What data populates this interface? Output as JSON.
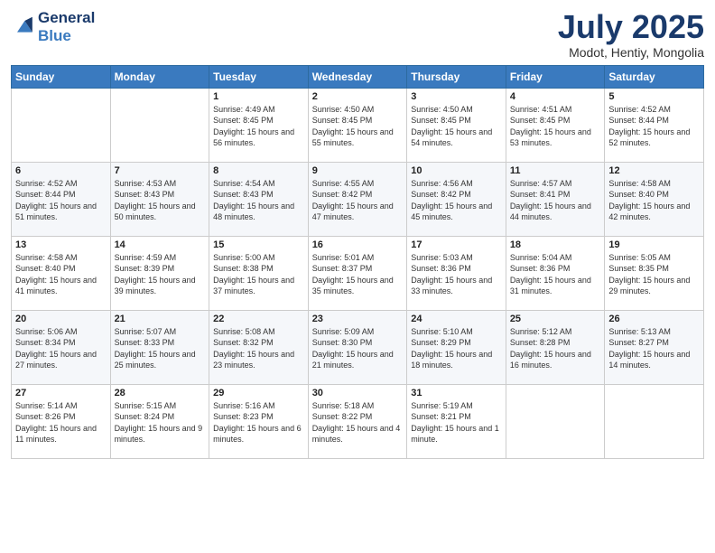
{
  "logo": {
    "line1": "General",
    "line2": "Blue"
  },
  "title": "July 2025",
  "location": "Modot, Hentiy, Mongolia",
  "days_header": [
    "Sunday",
    "Monday",
    "Tuesday",
    "Wednesday",
    "Thursday",
    "Friday",
    "Saturday"
  ],
  "weeks": [
    [
      {
        "day": "",
        "sunrise": "",
        "sunset": "",
        "daylight": ""
      },
      {
        "day": "",
        "sunrise": "",
        "sunset": "",
        "daylight": ""
      },
      {
        "day": "1",
        "sunrise": "Sunrise: 4:49 AM",
        "sunset": "Sunset: 8:45 PM",
        "daylight": "Daylight: 15 hours and 56 minutes."
      },
      {
        "day": "2",
        "sunrise": "Sunrise: 4:50 AM",
        "sunset": "Sunset: 8:45 PM",
        "daylight": "Daylight: 15 hours and 55 minutes."
      },
      {
        "day": "3",
        "sunrise": "Sunrise: 4:50 AM",
        "sunset": "Sunset: 8:45 PM",
        "daylight": "Daylight: 15 hours and 54 minutes."
      },
      {
        "day": "4",
        "sunrise": "Sunrise: 4:51 AM",
        "sunset": "Sunset: 8:45 PM",
        "daylight": "Daylight: 15 hours and 53 minutes."
      },
      {
        "day": "5",
        "sunrise": "Sunrise: 4:52 AM",
        "sunset": "Sunset: 8:44 PM",
        "daylight": "Daylight: 15 hours and 52 minutes."
      }
    ],
    [
      {
        "day": "6",
        "sunrise": "Sunrise: 4:52 AM",
        "sunset": "Sunset: 8:44 PM",
        "daylight": "Daylight: 15 hours and 51 minutes."
      },
      {
        "day": "7",
        "sunrise": "Sunrise: 4:53 AM",
        "sunset": "Sunset: 8:43 PM",
        "daylight": "Daylight: 15 hours and 50 minutes."
      },
      {
        "day": "8",
        "sunrise": "Sunrise: 4:54 AM",
        "sunset": "Sunset: 8:43 PM",
        "daylight": "Daylight: 15 hours and 48 minutes."
      },
      {
        "day": "9",
        "sunrise": "Sunrise: 4:55 AM",
        "sunset": "Sunset: 8:42 PM",
        "daylight": "Daylight: 15 hours and 47 minutes."
      },
      {
        "day": "10",
        "sunrise": "Sunrise: 4:56 AM",
        "sunset": "Sunset: 8:42 PM",
        "daylight": "Daylight: 15 hours and 45 minutes."
      },
      {
        "day": "11",
        "sunrise": "Sunrise: 4:57 AM",
        "sunset": "Sunset: 8:41 PM",
        "daylight": "Daylight: 15 hours and 44 minutes."
      },
      {
        "day": "12",
        "sunrise": "Sunrise: 4:58 AM",
        "sunset": "Sunset: 8:40 PM",
        "daylight": "Daylight: 15 hours and 42 minutes."
      }
    ],
    [
      {
        "day": "13",
        "sunrise": "Sunrise: 4:58 AM",
        "sunset": "Sunset: 8:40 PM",
        "daylight": "Daylight: 15 hours and 41 minutes."
      },
      {
        "day": "14",
        "sunrise": "Sunrise: 4:59 AM",
        "sunset": "Sunset: 8:39 PM",
        "daylight": "Daylight: 15 hours and 39 minutes."
      },
      {
        "day": "15",
        "sunrise": "Sunrise: 5:00 AM",
        "sunset": "Sunset: 8:38 PM",
        "daylight": "Daylight: 15 hours and 37 minutes."
      },
      {
        "day": "16",
        "sunrise": "Sunrise: 5:01 AM",
        "sunset": "Sunset: 8:37 PM",
        "daylight": "Daylight: 15 hours and 35 minutes."
      },
      {
        "day": "17",
        "sunrise": "Sunrise: 5:03 AM",
        "sunset": "Sunset: 8:36 PM",
        "daylight": "Daylight: 15 hours and 33 minutes."
      },
      {
        "day": "18",
        "sunrise": "Sunrise: 5:04 AM",
        "sunset": "Sunset: 8:36 PM",
        "daylight": "Daylight: 15 hours and 31 minutes."
      },
      {
        "day": "19",
        "sunrise": "Sunrise: 5:05 AM",
        "sunset": "Sunset: 8:35 PM",
        "daylight": "Daylight: 15 hours and 29 minutes."
      }
    ],
    [
      {
        "day": "20",
        "sunrise": "Sunrise: 5:06 AM",
        "sunset": "Sunset: 8:34 PM",
        "daylight": "Daylight: 15 hours and 27 minutes."
      },
      {
        "day": "21",
        "sunrise": "Sunrise: 5:07 AM",
        "sunset": "Sunset: 8:33 PM",
        "daylight": "Daylight: 15 hours and 25 minutes."
      },
      {
        "day": "22",
        "sunrise": "Sunrise: 5:08 AM",
        "sunset": "Sunset: 8:32 PM",
        "daylight": "Daylight: 15 hours and 23 minutes."
      },
      {
        "day": "23",
        "sunrise": "Sunrise: 5:09 AM",
        "sunset": "Sunset: 8:30 PM",
        "daylight": "Daylight: 15 hours and 21 minutes."
      },
      {
        "day": "24",
        "sunrise": "Sunrise: 5:10 AM",
        "sunset": "Sunset: 8:29 PM",
        "daylight": "Daylight: 15 hours and 18 minutes."
      },
      {
        "day": "25",
        "sunrise": "Sunrise: 5:12 AM",
        "sunset": "Sunset: 8:28 PM",
        "daylight": "Daylight: 15 hours and 16 minutes."
      },
      {
        "day": "26",
        "sunrise": "Sunrise: 5:13 AM",
        "sunset": "Sunset: 8:27 PM",
        "daylight": "Daylight: 15 hours and 14 minutes."
      }
    ],
    [
      {
        "day": "27",
        "sunrise": "Sunrise: 5:14 AM",
        "sunset": "Sunset: 8:26 PM",
        "daylight": "Daylight: 15 hours and 11 minutes."
      },
      {
        "day": "28",
        "sunrise": "Sunrise: 5:15 AM",
        "sunset": "Sunset: 8:24 PM",
        "daylight": "Daylight: 15 hours and 9 minutes."
      },
      {
        "day": "29",
        "sunrise": "Sunrise: 5:16 AM",
        "sunset": "Sunset: 8:23 PM",
        "daylight": "Daylight: 15 hours and 6 minutes."
      },
      {
        "day": "30",
        "sunrise": "Sunrise: 5:18 AM",
        "sunset": "Sunset: 8:22 PM",
        "daylight": "Daylight: 15 hours and 4 minutes."
      },
      {
        "day": "31",
        "sunrise": "Sunrise: 5:19 AM",
        "sunset": "Sunset: 8:21 PM",
        "daylight": "Daylight: 15 hours and 1 minute."
      },
      {
        "day": "",
        "sunrise": "",
        "sunset": "",
        "daylight": ""
      },
      {
        "day": "",
        "sunrise": "",
        "sunset": "",
        "daylight": ""
      }
    ]
  ]
}
